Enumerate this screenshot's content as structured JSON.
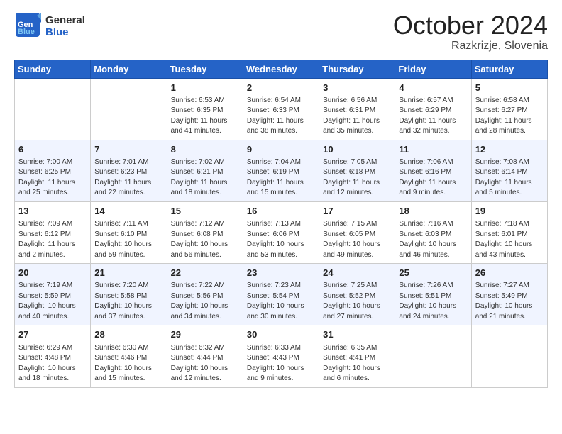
{
  "header": {
    "logo_general": "General",
    "logo_blue": "Blue",
    "month_title": "October 2024",
    "location": "Razkrizje, Slovenia"
  },
  "weekdays": [
    "Sunday",
    "Monday",
    "Tuesday",
    "Wednesday",
    "Thursday",
    "Friday",
    "Saturday"
  ],
  "weeks": [
    [
      {
        "day": "",
        "sunrise": "",
        "sunset": "",
        "daylight": ""
      },
      {
        "day": "",
        "sunrise": "",
        "sunset": "",
        "daylight": ""
      },
      {
        "day": "1",
        "sunrise": "Sunrise: 6:53 AM",
        "sunset": "Sunset: 6:35 PM",
        "daylight": "Daylight: 11 hours and 41 minutes."
      },
      {
        "day": "2",
        "sunrise": "Sunrise: 6:54 AM",
        "sunset": "Sunset: 6:33 PM",
        "daylight": "Daylight: 11 hours and 38 minutes."
      },
      {
        "day": "3",
        "sunrise": "Sunrise: 6:56 AM",
        "sunset": "Sunset: 6:31 PM",
        "daylight": "Daylight: 11 hours and 35 minutes."
      },
      {
        "day": "4",
        "sunrise": "Sunrise: 6:57 AM",
        "sunset": "Sunset: 6:29 PM",
        "daylight": "Daylight: 11 hours and 32 minutes."
      },
      {
        "day": "5",
        "sunrise": "Sunrise: 6:58 AM",
        "sunset": "Sunset: 6:27 PM",
        "daylight": "Daylight: 11 hours and 28 minutes."
      }
    ],
    [
      {
        "day": "6",
        "sunrise": "Sunrise: 7:00 AM",
        "sunset": "Sunset: 6:25 PM",
        "daylight": "Daylight: 11 hours and 25 minutes."
      },
      {
        "day": "7",
        "sunrise": "Sunrise: 7:01 AM",
        "sunset": "Sunset: 6:23 PM",
        "daylight": "Daylight: 11 hours and 22 minutes."
      },
      {
        "day": "8",
        "sunrise": "Sunrise: 7:02 AM",
        "sunset": "Sunset: 6:21 PM",
        "daylight": "Daylight: 11 hours and 18 minutes."
      },
      {
        "day": "9",
        "sunrise": "Sunrise: 7:04 AM",
        "sunset": "Sunset: 6:19 PM",
        "daylight": "Daylight: 11 hours and 15 minutes."
      },
      {
        "day": "10",
        "sunrise": "Sunrise: 7:05 AM",
        "sunset": "Sunset: 6:18 PM",
        "daylight": "Daylight: 11 hours and 12 minutes."
      },
      {
        "day": "11",
        "sunrise": "Sunrise: 7:06 AM",
        "sunset": "Sunset: 6:16 PM",
        "daylight": "Daylight: 11 hours and 9 minutes."
      },
      {
        "day": "12",
        "sunrise": "Sunrise: 7:08 AM",
        "sunset": "Sunset: 6:14 PM",
        "daylight": "Daylight: 11 hours and 5 minutes."
      }
    ],
    [
      {
        "day": "13",
        "sunrise": "Sunrise: 7:09 AM",
        "sunset": "Sunset: 6:12 PM",
        "daylight": "Daylight: 11 hours and 2 minutes."
      },
      {
        "day": "14",
        "sunrise": "Sunrise: 7:11 AM",
        "sunset": "Sunset: 6:10 PM",
        "daylight": "Daylight: 10 hours and 59 minutes."
      },
      {
        "day": "15",
        "sunrise": "Sunrise: 7:12 AM",
        "sunset": "Sunset: 6:08 PM",
        "daylight": "Daylight: 10 hours and 56 minutes."
      },
      {
        "day": "16",
        "sunrise": "Sunrise: 7:13 AM",
        "sunset": "Sunset: 6:06 PM",
        "daylight": "Daylight: 10 hours and 53 minutes."
      },
      {
        "day": "17",
        "sunrise": "Sunrise: 7:15 AM",
        "sunset": "Sunset: 6:05 PM",
        "daylight": "Daylight: 10 hours and 49 minutes."
      },
      {
        "day": "18",
        "sunrise": "Sunrise: 7:16 AM",
        "sunset": "Sunset: 6:03 PM",
        "daylight": "Daylight: 10 hours and 46 minutes."
      },
      {
        "day": "19",
        "sunrise": "Sunrise: 7:18 AM",
        "sunset": "Sunset: 6:01 PM",
        "daylight": "Daylight: 10 hours and 43 minutes."
      }
    ],
    [
      {
        "day": "20",
        "sunrise": "Sunrise: 7:19 AM",
        "sunset": "Sunset: 5:59 PM",
        "daylight": "Daylight: 10 hours and 40 minutes."
      },
      {
        "day": "21",
        "sunrise": "Sunrise: 7:20 AM",
        "sunset": "Sunset: 5:58 PM",
        "daylight": "Daylight: 10 hours and 37 minutes."
      },
      {
        "day": "22",
        "sunrise": "Sunrise: 7:22 AM",
        "sunset": "Sunset: 5:56 PM",
        "daylight": "Daylight: 10 hours and 34 minutes."
      },
      {
        "day": "23",
        "sunrise": "Sunrise: 7:23 AM",
        "sunset": "Sunset: 5:54 PM",
        "daylight": "Daylight: 10 hours and 30 minutes."
      },
      {
        "day": "24",
        "sunrise": "Sunrise: 7:25 AM",
        "sunset": "Sunset: 5:52 PM",
        "daylight": "Daylight: 10 hours and 27 minutes."
      },
      {
        "day": "25",
        "sunrise": "Sunrise: 7:26 AM",
        "sunset": "Sunset: 5:51 PM",
        "daylight": "Daylight: 10 hours and 24 minutes."
      },
      {
        "day": "26",
        "sunrise": "Sunrise: 7:27 AM",
        "sunset": "Sunset: 5:49 PM",
        "daylight": "Daylight: 10 hours and 21 minutes."
      }
    ],
    [
      {
        "day": "27",
        "sunrise": "Sunrise: 6:29 AM",
        "sunset": "Sunset: 4:48 PM",
        "daylight": "Daylight: 10 hours and 18 minutes."
      },
      {
        "day": "28",
        "sunrise": "Sunrise: 6:30 AM",
        "sunset": "Sunset: 4:46 PM",
        "daylight": "Daylight: 10 hours and 15 minutes."
      },
      {
        "day": "29",
        "sunrise": "Sunrise: 6:32 AM",
        "sunset": "Sunset: 4:44 PM",
        "daylight": "Daylight: 10 hours and 12 minutes."
      },
      {
        "day": "30",
        "sunrise": "Sunrise: 6:33 AM",
        "sunset": "Sunset: 4:43 PM",
        "daylight": "Daylight: 10 hours and 9 minutes."
      },
      {
        "day": "31",
        "sunrise": "Sunrise: 6:35 AM",
        "sunset": "Sunset: 4:41 PM",
        "daylight": "Daylight: 10 hours and 6 minutes."
      },
      {
        "day": "",
        "sunrise": "",
        "sunset": "",
        "daylight": ""
      },
      {
        "day": "",
        "sunrise": "",
        "sunset": "",
        "daylight": ""
      }
    ]
  ]
}
